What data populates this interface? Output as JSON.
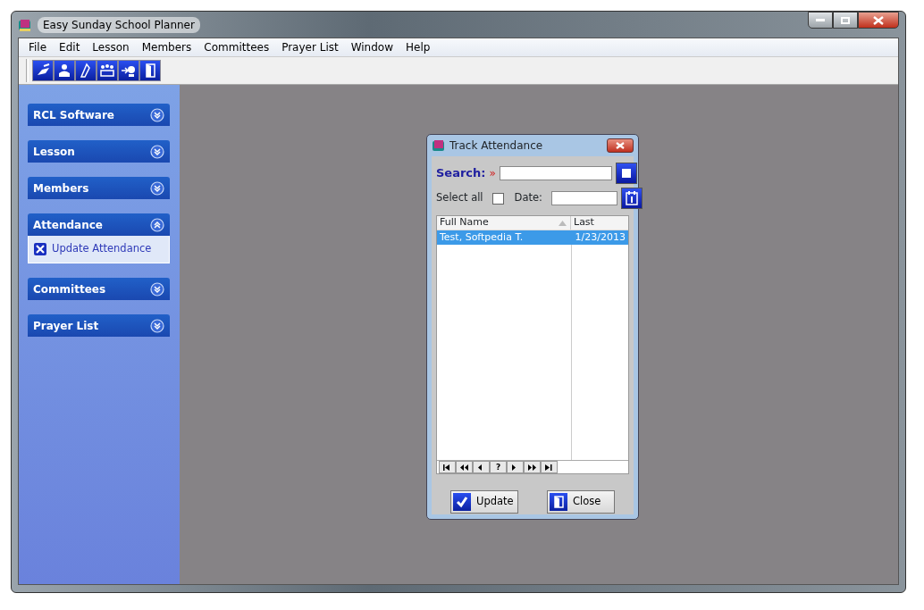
{
  "window": {
    "title": "Easy Sunday School Planner"
  },
  "menu": [
    "File",
    "Edit",
    "Lesson",
    "Members",
    "Committees",
    "Prayer List",
    "Window",
    "Help"
  ],
  "sidebar": {
    "groups": [
      {
        "title": "RCL Software",
        "expanded": false
      },
      {
        "title": "Lesson",
        "expanded": false
      },
      {
        "title": "Members",
        "expanded": false
      },
      {
        "title": "Attendance",
        "expanded": true,
        "items": [
          "Update Attendance"
        ]
      },
      {
        "title": "Committees",
        "expanded": false
      },
      {
        "title": "Prayer List",
        "expanded": false
      }
    ]
  },
  "dialog": {
    "title": "Track Attendance",
    "search": {
      "label": "Search:",
      "marker": "»"
    },
    "select_all": {
      "label": "Select all",
      "checked": false
    },
    "date": {
      "label": "Date:"
    },
    "table": {
      "columns": [
        "Full Name",
        "Last"
      ],
      "rows": [
        {
          "cells": [
            "Test, Softpedia T.",
            "1/23/2013"
          ],
          "selected": true
        }
      ]
    },
    "navigator": [
      {
        "kind": "first"
      },
      {
        "kind": "prev-page"
      },
      {
        "kind": "prev"
      },
      {
        "kind": "help",
        "label": "?"
      },
      {
        "kind": "next"
      },
      {
        "kind": "next-page"
      },
      {
        "kind": "last"
      }
    ],
    "buttons": [
      {
        "kind": "update",
        "label": "Update"
      },
      {
        "kind": "close",
        "label": "Close"
      }
    ]
  }
}
